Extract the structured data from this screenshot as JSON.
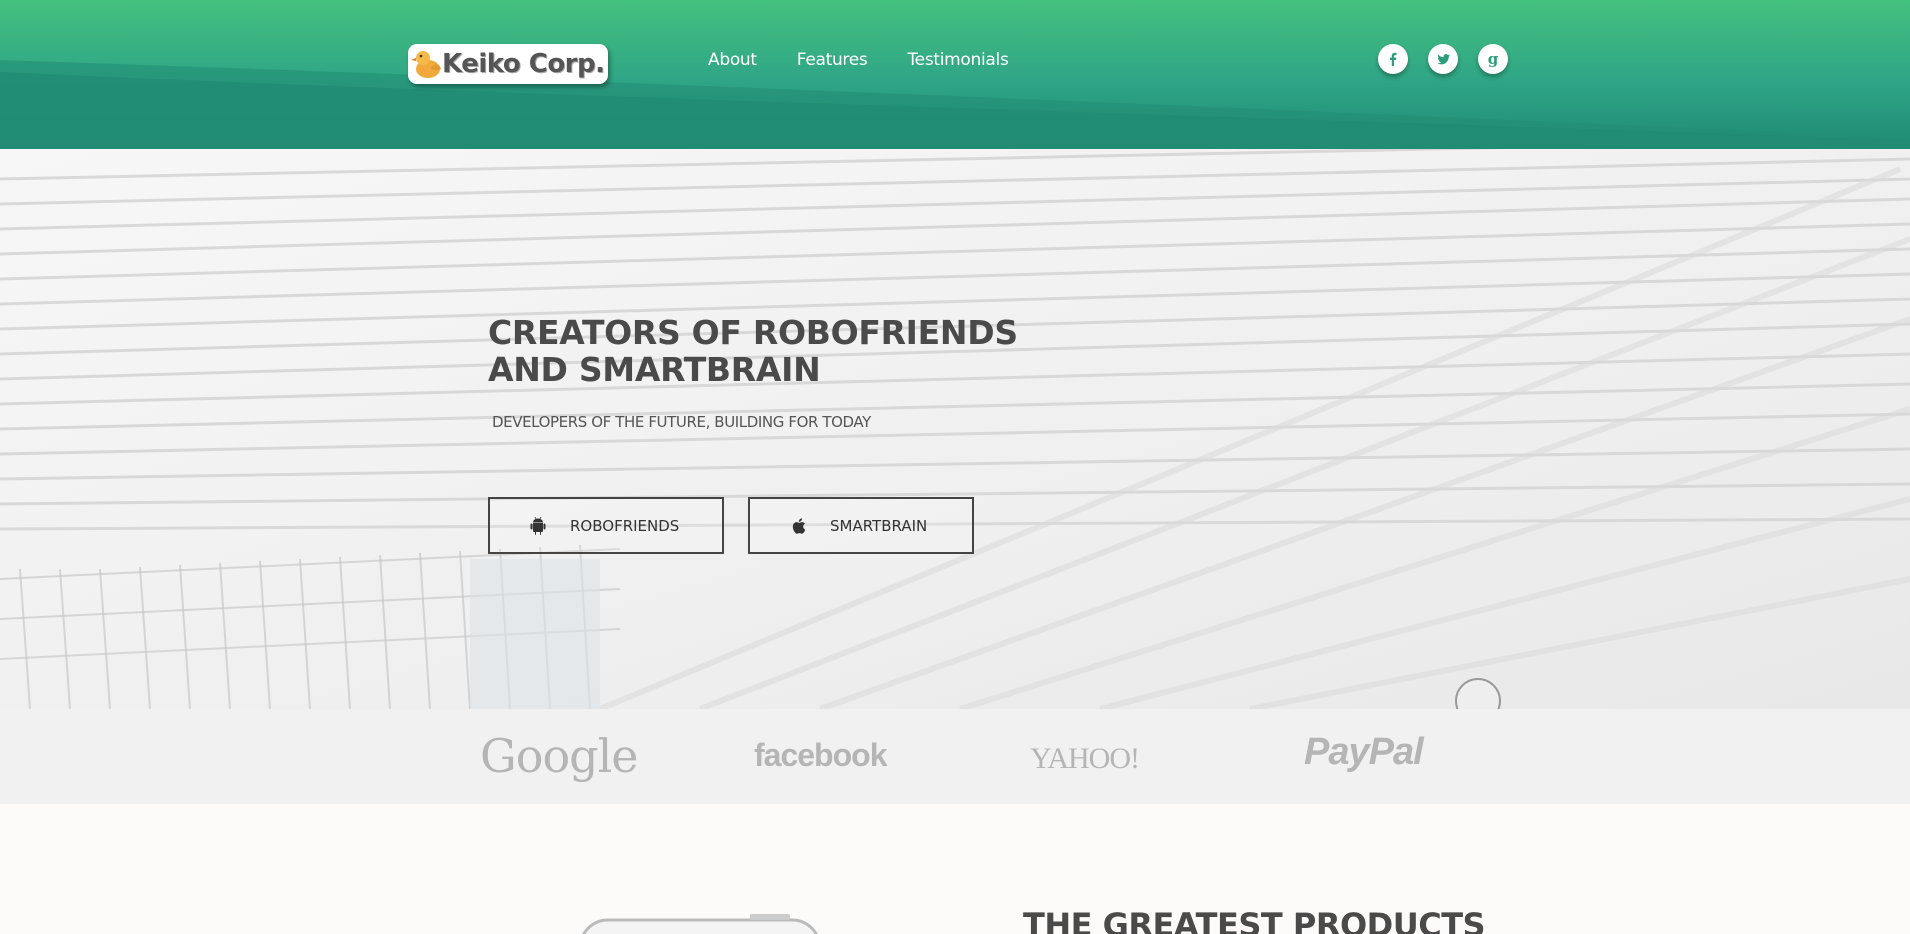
{
  "brand": {
    "name": "Keiko Corp.",
    "logo_icon": "duck-icon"
  },
  "nav": {
    "links": [
      "About",
      "Features",
      "Testimonials"
    ]
  },
  "social": [
    {
      "icon": "facebook-icon",
      "glyph": "f"
    },
    {
      "icon": "twitter-icon",
      "glyph": "t"
    },
    {
      "icon": "google-icon",
      "glyph": "g"
    }
  ],
  "hero": {
    "title_line1": "CREATORS OF ROBOFRIENDS",
    "title_line2": "AND SMARTBRAIN",
    "subtitle": "DEVELOPERS OF THE FUTURE, BUILDING FOR TODAY",
    "buttons": [
      {
        "label": "ROBOFRIENDS",
        "icon": "android-icon"
      },
      {
        "label": "SMARTBRAIN",
        "icon": "apple-icon"
      }
    ]
  },
  "partners": [
    "Google",
    "facebook",
    "YAHOO!",
    "PayPal"
  ],
  "products": {
    "title": "THE GREATEST PRODUCTS"
  },
  "colors": {
    "header_top": "#45c17f",
    "header_bottom": "#1f8a74",
    "text_dark": "#4a4a4a",
    "partner_gray": "#b5b5b5"
  }
}
